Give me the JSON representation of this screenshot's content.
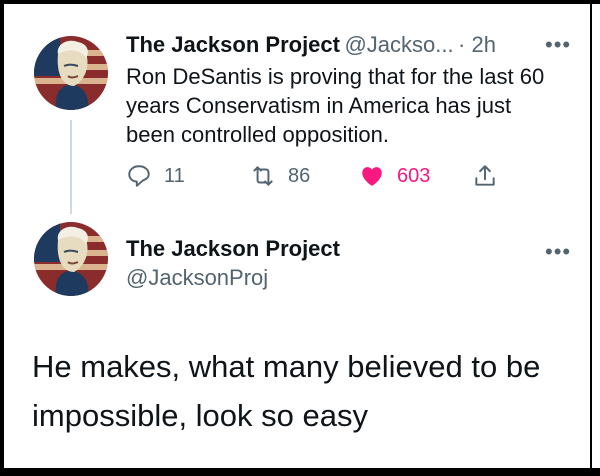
{
  "tweet1": {
    "display_name": "The Jackson Project",
    "handle": "@Jackso...",
    "time": "· 2h",
    "more_icon": "more-horizontal-icon",
    "text": "Ron DeSantis is proving that for the last 60 years Conservatism in America has just been controlled opposition.",
    "actions": {
      "reply_count": "11",
      "retweet_count": "86",
      "like_count": "603",
      "like_color": "#f91880"
    }
  },
  "tweet2": {
    "display_name": "The Jackson Project",
    "handle": "@JacksonProj",
    "more_icon": "more-horizontal-icon",
    "text": "He makes, what many believed to be impossible, look so easy"
  },
  "colors": {
    "text": "#0f1419",
    "muted": "#536471",
    "thread_line": "#cfd9de",
    "avatar_red": "#c0392b",
    "avatar_navy": "#1f3a5f"
  }
}
